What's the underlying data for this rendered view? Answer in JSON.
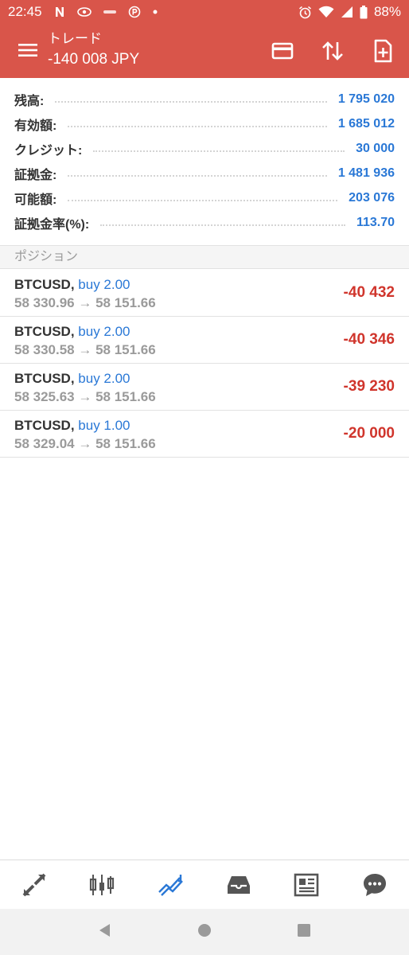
{
  "status_bar": {
    "time": "22:45",
    "battery": "88%",
    "icons": [
      "netflix-n-icon",
      "eye-icon",
      "app-icon",
      "parking-icon",
      "dot-icon",
      "alarm-icon",
      "wifi-icon",
      "signal-icon",
      "battery-icon"
    ]
  },
  "app_bar": {
    "title": "トレード",
    "subtitle": "-140 008 JPY",
    "actions": [
      "card-icon",
      "sort-arrows-icon",
      "new-order-icon"
    ]
  },
  "summary": [
    {
      "label": "残高:",
      "value": "1 795 020"
    },
    {
      "label": "有効額:",
      "value": "1 685 012"
    },
    {
      "label": "クレジット:",
      "value": "30 000"
    },
    {
      "label": "証拠金:",
      "value": "1 481 936"
    },
    {
      "label": "可能額:",
      "value": "203 076"
    },
    {
      "label": "証拠金率(%):",
      "value": "113.70"
    }
  ],
  "positions_header": "ポジション",
  "positions": [
    {
      "symbol": "BTCUSD,",
      "type": "buy 2.00",
      "prices": "58 330.96 → 58 151.66",
      "profit": "-40 432"
    },
    {
      "symbol": "BTCUSD,",
      "type": "buy 2.00",
      "prices": "58 330.58 → 58 151.66",
      "profit": "-40 346"
    },
    {
      "symbol": "BTCUSD,",
      "type": "buy 2.00",
      "prices": "58 325.63 → 58 151.66",
      "profit": "-39 230"
    },
    {
      "symbol": "BTCUSD,",
      "type": "buy 1.00",
      "prices": "58 329.04 → 58 151.66",
      "profit": "-20 000"
    }
  ],
  "bottom_nav": [
    "quotes-icon",
    "chart-icon",
    "trade-icon",
    "history-icon",
    "news-icon",
    "chat-icon"
  ],
  "colors": {
    "accent": "#d9554a",
    "value_blue": "#2a78d6",
    "loss_red": "#d0352c",
    "active_nav": "#2a78d6"
  }
}
